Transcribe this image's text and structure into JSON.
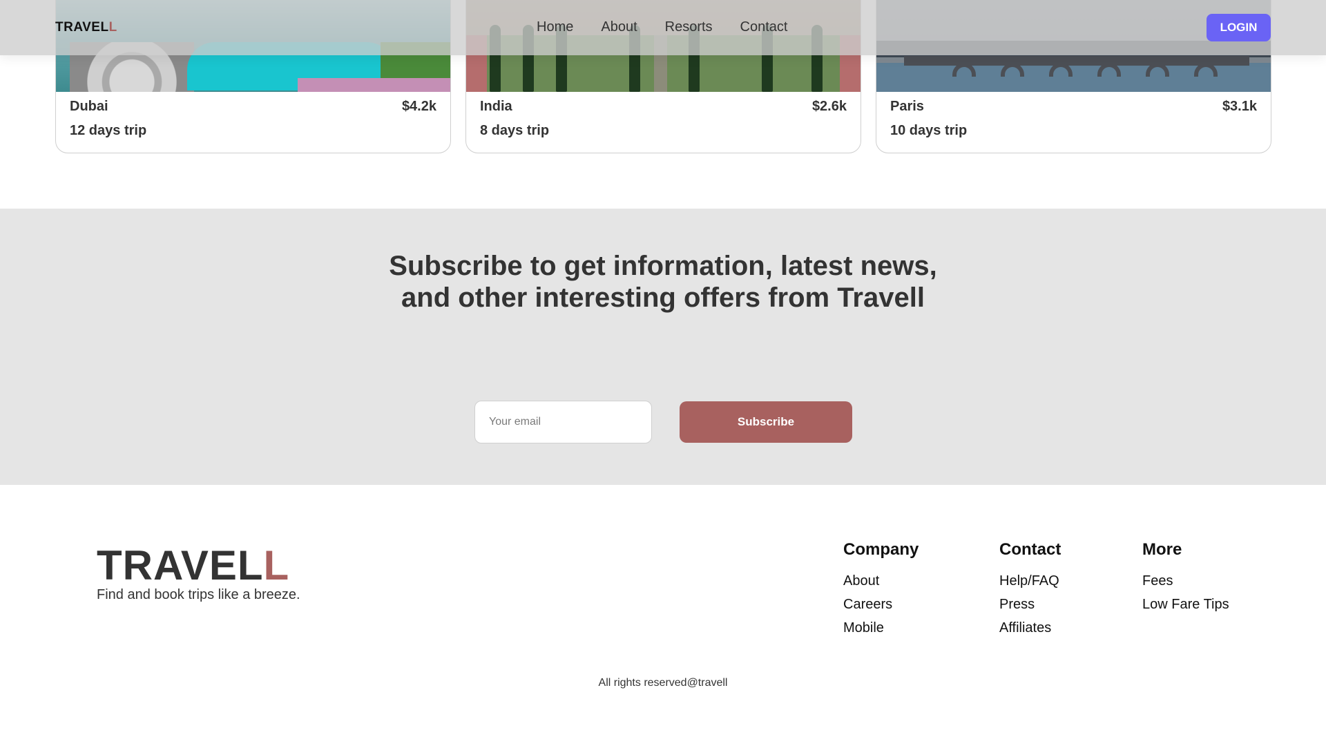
{
  "header": {
    "logo_main": "TRAVEL",
    "logo_accent": "L",
    "nav": [
      "Home",
      "About",
      "Resorts",
      "Contact"
    ],
    "login_label": "LOGIN"
  },
  "trips": [
    {
      "name": "Dubai",
      "price": "$4.2k",
      "duration": "12 days trip"
    },
    {
      "name": "India",
      "price": "$2.6k",
      "duration": "8 days trip"
    },
    {
      "name": "Paris",
      "price": "$3.1k",
      "duration": "10 days trip"
    }
  ],
  "subscribe": {
    "title": "Subscribe to get information, latest news, and other interesting offers from Travell",
    "email_placeholder": "Your email",
    "button_label": "Subscribe"
  },
  "footer": {
    "logo_main": "TRAVEL",
    "logo_accent": "L",
    "tagline": "Find and book trips like a breeze.",
    "columns": [
      {
        "title": "Company",
        "links": [
          "About",
          "Careers",
          "Mobile"
        ]
      },
      {
        "title": "Contact",
        "links": [
          "Help/FAQ",
          "Press",
          "Affiliates"
        ]
      },
      {
        "title": "More",
        "links": [
          "Fees",
          "Low Fare Tips"
        ]
      }
    ],
    "copyright": "All rights reserved@travell"
  },
  "colors": {
    "accent": "#a8615f",
    "login": "#6a63f5",
    "subscribe_bg": "#e5e5e5"
  }
}
